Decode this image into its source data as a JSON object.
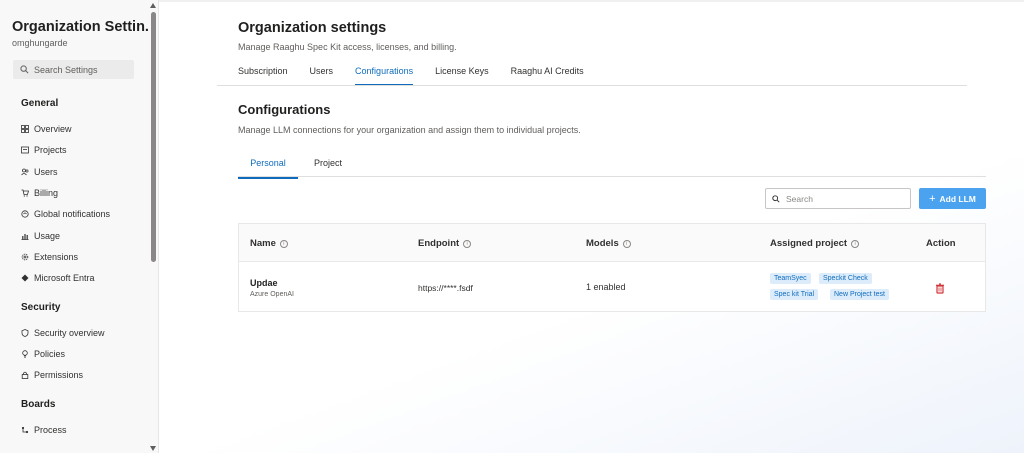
{
  "sidebar": {
    "title": "Organization Settin...",
    "org": "omghungarde",
    "search_placeholder": "Search Settings",
    "groups": [
      {
        "label": "General"
      },
      {
        "label": "Security"
      },
      {
        "label": "Boards"
      }
    ],
    "items": [
      {
        "label": "Overview",
        "icon": "grid-icon"
      },
      {
        "label": "Projects",
        "icon": "projects-icon"
      },
      {
        "label": "Users",
        "icon": "users-icon"
      },
      {
        "label": "Billing",
        "icon": "cart-icon"
      },
      {
        "label": "Global notifications",
        "icon": "notification-icon"
      },
      {
        "label": "Usage",
        "icon": "usage-icon"
      },
      {
        "label": "Extensions",
        "icon": "gear-icon"
      },
      {
        "label": "Microsoft Entra",
        "icon": "entra-icon"
      },
      {
        "label": "Security overview",
        "icon": "shield-icon"
      },
      {
        "label": "Policies",
        "icon": "lightbulb-icon"
      },
      {
        "label": "Permissions",
        "icon": "lock-icon"
      },
      {
        "label": "Process",
        "icon": "process-icon"
      }
    ]
  },
  "header": {
    "title": "Organization settings",
    "subtitle": "Manage Raaghu Spec Kit access, licenses, and billing.",
    "tabs": [
      {
        "label": "Subscription"
      },
      {
        "label": "Users"
      },
      {
        "label": "Configurations"
      },
      {
        "label": "License Keys"
      },
      {
        "label": "Raaghu AI Credits"
      }
    ],
    "active_tab": "Configurations"
  },
  "configurations": {
    "title": "Configurations",
    "subtitle": "Manage LLM connections for your organization and assign them to individual projects.",
    "subtabs": [
      {
        "label": "Personal"
      },
      {
        "label": "Project"
      }
    ],
    "active_subtab": "Personal",
    "search_placeholder": "Search",
    "add_button": "Add LLM",
    "add_icon": "+",
    "columns": [
      {
        "label": "Name"
      },
      {
        "label": "Endpoint"
      },
      {
        "label": "Models"
      },
      {
        "label": "Assigned project"
      },
      {
        "label": "Action"
      }
    ],
    "info_glyph": "i",
    "rows": [
      {
        "name": "Updae",
        "provider": "Azure OpenAI",
        "endpoint": "https://****.fsdf",
        "models": "1 enabled",
        "projects": [
          "TeamSyec",
          "Speckit Check",
          "Spec kit Trial",
          "New Project test"
        ],
        "action_icon": "trash-icon"
      }
    ]
  },
  "colors": {
    "accent": "#0f6cbd",
    "button": "#4ba3f0",
    "tag_bg": "#dcecfb",
    "delete": "#d13438"
  }
}
